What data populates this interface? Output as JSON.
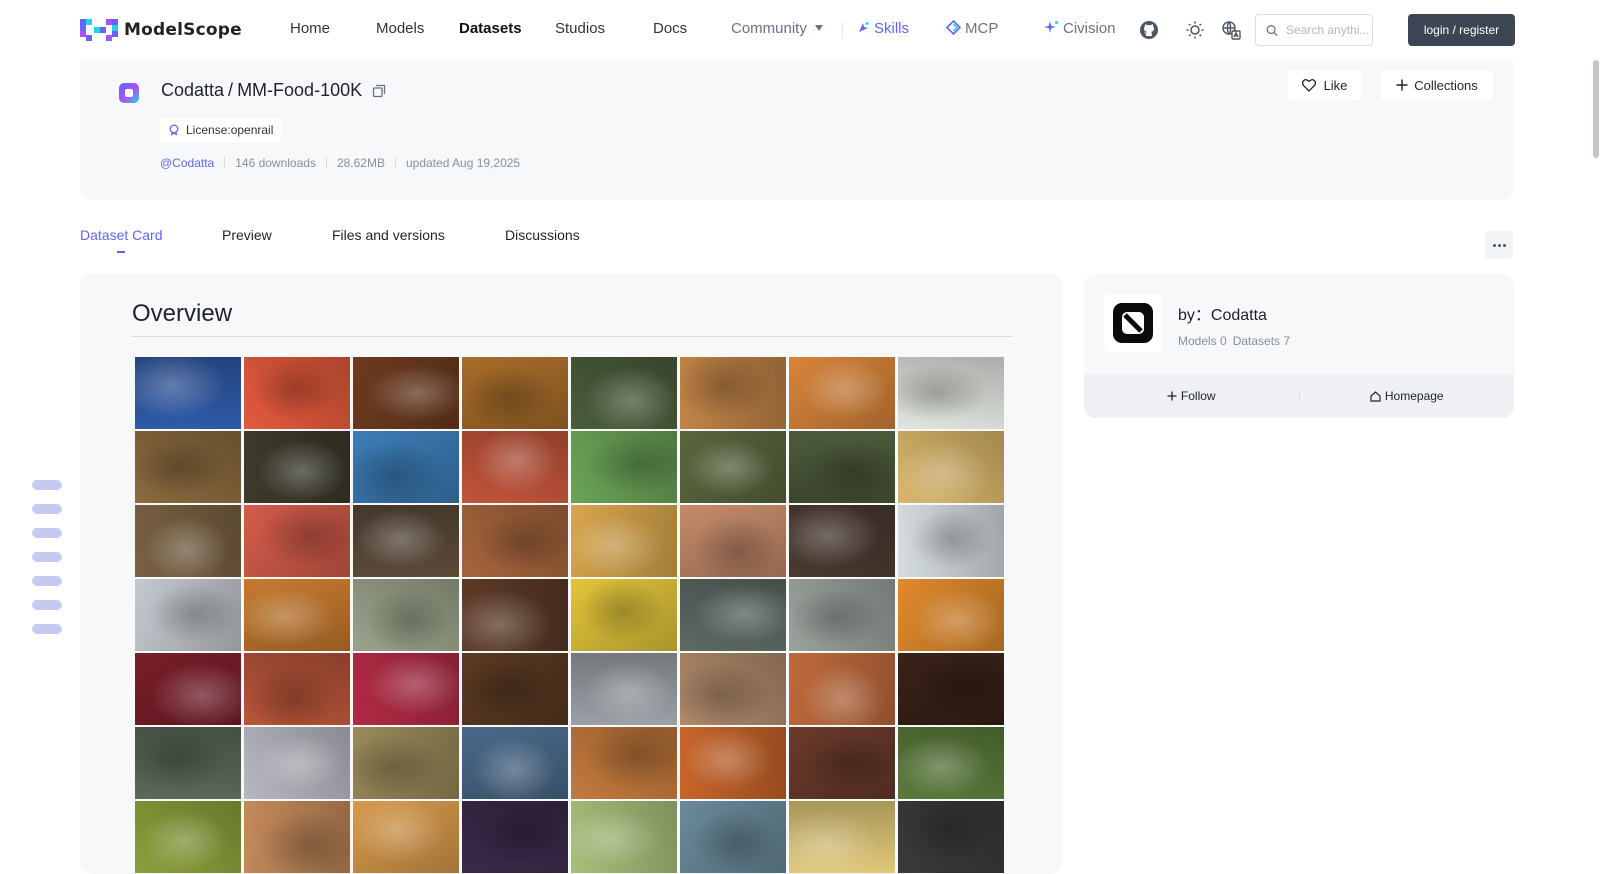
{
  "brand": {
    "name": "ModelScope",
    "accent": "#6366f1"
  },
  "nav": {
    "home": "Home",
    "models": "Models",
    "datasets": "Datasets",
    "studios": "Studios",
    "docs": "Docs",
    "community": "Community",
    "skills": "Skills",
    "mcp": "MCP",
    "civision": "Civision",
    "search_placeholder": "Search anythi...",
    "login": "login / register"
  },
  "dataset": {
    "owner": "Codatta",
    "slash": "/",
    "name": "MM-Food-100K",
    "license": "License:openrail",
    "author": "@Codatta",
    "downloads": "146 downloads",
    "size": "28.62MB",
    "updated": "updated Aug 19,2025"
  },
  "actions": {
    "like": "Like",
    "collections": "Collections"
  },
  "tabs": [
    "Dataset Card",
    "Preview",
    "Files and versions",
    "Discussions"
  ],
  "content": {
    "overview_title": "Overview",
    "image_grid": {
      "columns": 8,
      "visible_rows": 7,
      "palettes": [
        [
          "#2f5aa8",
          "#e45a3c",
          "#6d3b1f",
          "#a86d2a",
          "#4a5d3a",
          "#c18447",
          "#d8843a",
          "#e2e6e0"
        ],
        [
          "#8a6a3e",
          "#3c3a2a",
          "#3d7eb8",
          "#c2543a",
          "#6aa356",
          "#59673e",
          "#4d5b3b",
          "#d9b66a"
        ],
        [
          "#7a6142",
          "#d45c4a",
          "#5b4a3a",
          "#a6653c",
          "#d8a64c",
          "#c58b6a",
          "#4a3a30",
          "#d6dde0"
        ],
        [
          "#c4c9cf",
          "#c77a2f",
          "#9aa38a",
          "#5c3a26",
          "#e2c53a",
          "#5c6a64",
          "#9aa29c",
          "#e08a2c"
        ],
        [
          "#7a1e2a",
          "#b8553a",
          "#b22a45",
          "#5a3a22",
          "#9aa0a6",
          "#b08a6a",
          "#c06a3c",
          "#3a2218"
        ],
        [
          "#5a6a5a",
          "#b8b8c2",
          "#9a8a5a",
          "#4a6a8a",
          "#c47a3c",
          "#c8652a",
          "#6a3a2a",
          "#5a7a3a"
        ],
        [
          "#8aa03a",
          "#c48a5a",
          "#d89a4a",
          "#3a2a4a",
          "#a8c07a",
          "#6a8a9a",
          "#e0c878",
          "#3a3a3a"
        ]
      ]
    }
  },
  "author_card": {
    "by": "by：Codatta",
    "models": "Models 0",
    "datasets": "Datasets 7",
    "follow": "Follow",
    "homepage": "Homepage"
  }
}
